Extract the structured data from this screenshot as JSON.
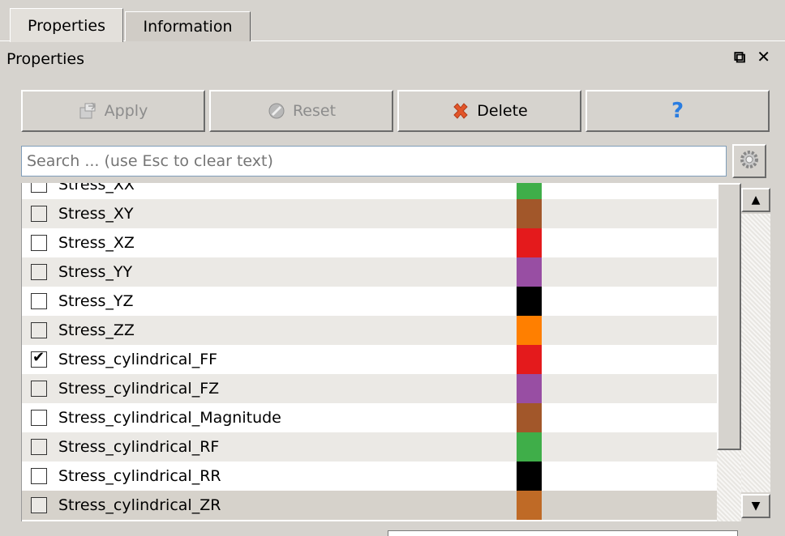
{
  "tabs": [
    {
      "label": "Properties"
    },
    {
      "label": "Information"
    }
  ],
  "dock": {
    "title": "Properties",
    "float_icon": "⧉",
    "close_icon": "✕"
  },
  "toolbar": {
    "apply_label": "Apply",
    "reset_label": "Reset",
    "delete_label": "Delete",
    "help_label": "?"
  },
  "search": {
    "placeholder": "Search ... (use Esc to clear text)"
  },
  "list": {
    "rows": [
      {
        "label": "Stress_XX",
        "checked": false,
        "color": "#3fae49"
      },
      {
        "label": "Stress_XY",
        "checked": false,
        "color": "#a2572a"
      },
      {
        "label": "Stress_XZ",
        "checked": false,
        "color": "#e41a1c"
      },
      {
        "label": "Stress_YY",
        "checked": false,
        "color": "#984ea3"
      },
      {
        "label": "Stress_YZ",
        "checked": false,
        "color": "#000000"
      },
      {
        "label": "Stress_ZZ",
        "checked": false,
        "color": "#ff7f00"
      },
      {
        "label": "Stress_cylindrical_FF",
        "checked": true,
        "color": "#e41a1c"
      },
      {
        "label": "Stress_cylindrical_FZ",
        "checked": false,
        "color": "#984ea3"
      },
      {
        "label": "Stress_cylindrical_Magnitude",
        "checked": false,
        "color": "#a2572a"
      },
      {
        "label": "Stress_cylindrical_RF",
        "checked": false,
        "color": "#3fae49"
      },
      {
        "label": "Stress_cylindrical_RR",
        "checked": false,
        "color": "#000000"
      },
      {
        "label": "Stress_cylindrical_ZR",
        "checked": false,
        "color": "#bf6a26"
      }
    ]
  },
  "colors": {
    "delete_x": "#e2562a",
    "help_q": "#2a7de1"
  }
}
